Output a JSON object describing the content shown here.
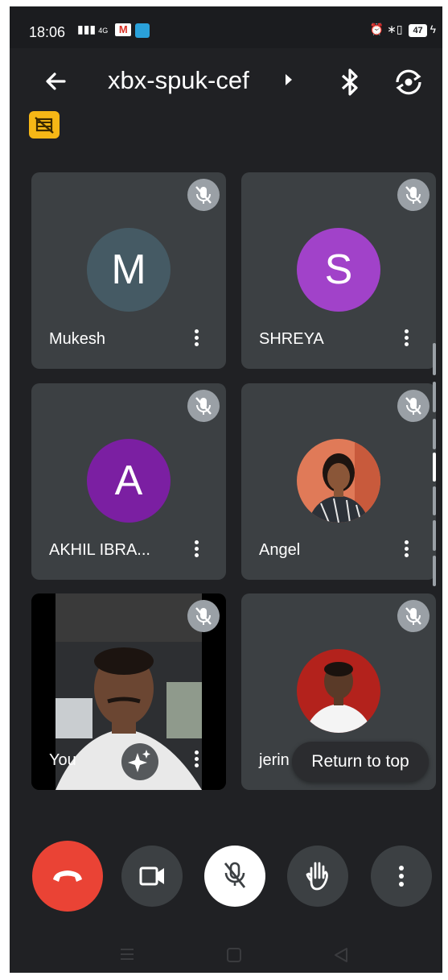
{
  "status_bar": {
    "time": "18:06",
    "network": "4G",
    "network_type": "VoLTE",
    "notification_icons": [
      "gmail-icon",
      "telegram-icon"
    ],
    "battery_level": "47"
  },
  "header": {
    "meeting_code": "xbx-spuk-cef"
  },
  "participants": [
    {
      "name": "Mukesh",
      "initial": "M",
      "avatar_color": "#455a64",
      "muted": true
    },
    {
      "name": "SHREYA",
      "initial": "S",
      "avatar_color": "#a142c9",
      "muted": true
    },
    {
      "name": "AKHIL IBRA...",
      "initial": "A",
      "avatar_color": "#7b1fa2",
      "muted": true
    },
    {
      "name": "Angel",
      "muted": true
    },
    {
      "name": "You",
      "muted": true
    },
    {
      "name": "jerin",
      "muted": true
    }
  ],
  "return_to_top_label": "Return to top",
  "colors": {
    "background": "#202124",
    "tile": "#3c4043",
    "end_call": "#ea4335",
    "rec_badge": "#f6b716"
  }
}
